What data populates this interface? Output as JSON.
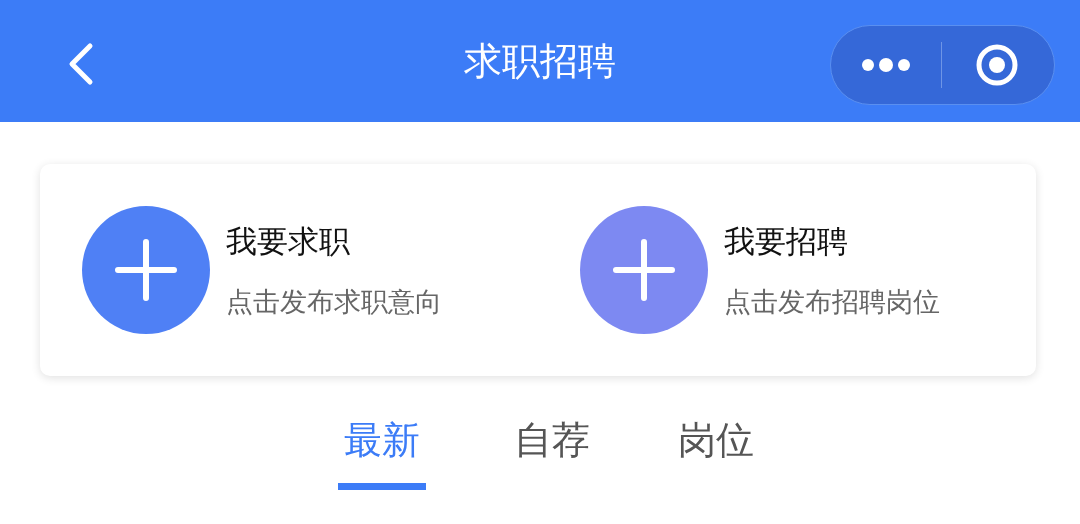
{
  "header": {
    "title": "求职招聘"
  },
  "actions": [
    {
      "title": "我要求职",
      "subtitle": "点击发布求职意向",
      "color": "#4f80f5"
    },
    {
      "title": "我要招聘",
      "subtitle": "点击发布招聘岗位",
      "color": "#7d89f2"
    }
  ],
  "tabs": [
    {
      "label": "最新",
      "selected": true
    },
    {
      "label": "自荐",
      "selected": false
    },
    {
      "label": "岗位",
      "selected": false
    }
  ]
}
